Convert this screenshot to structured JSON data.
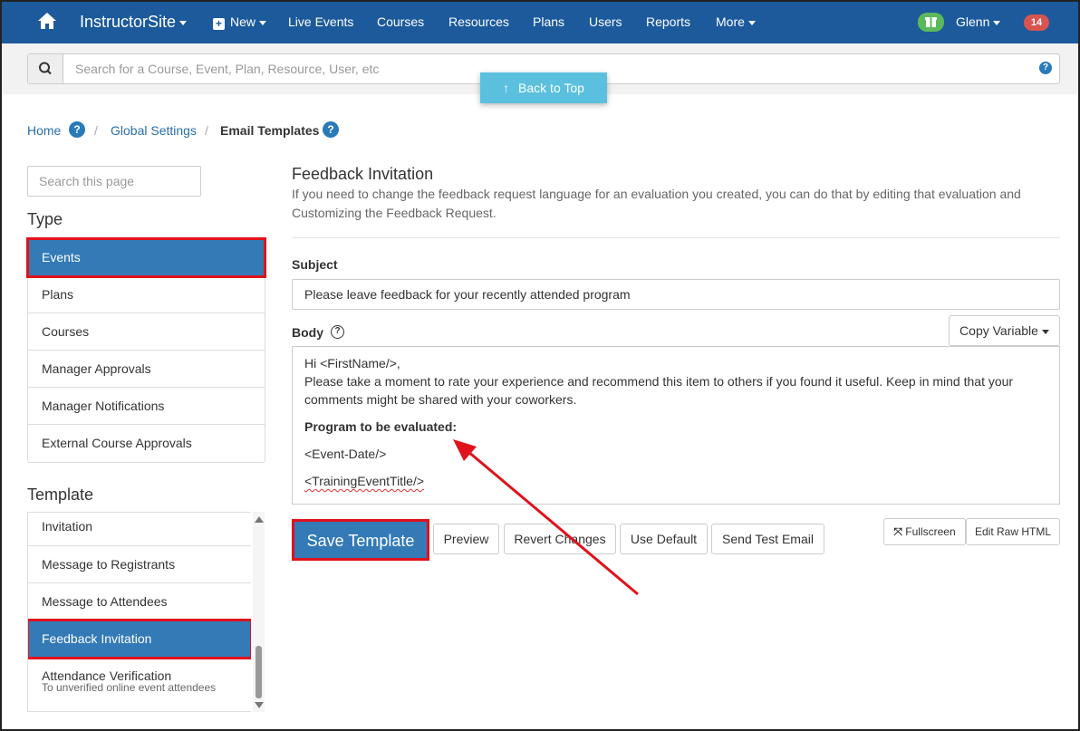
{
  "topnav": {
    "brand": "InstructorSite",
    "new_label": "New",
    "items": [
      "Live Events",
      "Courses",
      "Resources",
      "Plans",
      "Users",
      "Reports"
    ],
    "more_label": "More",
    "user_name": "Glenn",
    "notification_count": "14"
  },
  "search": {
    "placeholder": "Search for a Course, Event, Plan, Resource, User, etc"
  },
  "back_to_top": "Back to Top",
  "breadcrumb": {
    "home": "Home",
    "global_settings": "Global Settings",
    "current": "Email Templates",
    "separator": "/"
  },
  "sidebar": {
    "search_placeholder": "Search this page",
    "type_heading": "Type",
    "types": [
      "Events",
      "Plans",
      "Courses",
      "Manager Approvals",
      "Manager Notifications",
      "External Course Approvals"
    ],
    "template_heading": "Template",
    "templates": [
      "Invitation",
      "Message to Registrants",
      "Message to Attendees",
      "Feedback Invitation",
      "Attendance Verification"
    ],
    "attendance_sub": "To unverified online event attendees"
  },
  "main": {
    "title": "Feedback Invitation",
    "description": "If you need to change the feedback request language for an evaluation you created, you can do that by editing that evaluation and Customizing the Feedback Request.",
    "subject_label": "Subject",
    "subject_value": "Please leave feedback for your recently attended program",
    "body_label": "Body",
    "copy_variable": "Copy Variable",
    "body": {
      "line1": "Hi <FirstName/>,",
      "line2": "Please take a moment to rate your experience and recommend this item to others if you found it useful. Keep in mind that your comments might be shared with your coworkers.",
      "heading": "Program to be evaluated:",
      "var1": "<Event-Date/>",
      "var2": "<TrainingEventTitle/>"
    },
    "buttons": {
      "save": "Save Template",
      "preview": "Preview",
      "revert": "Revert Changes",
      "default": "Use Default",
      "test": "Send Test Email",
      "fullscreen": "Fullscreen",
      "raw": "Edit Raw HTML"
    }
  },
  "colors": {
    "nav": "#1c5a9c",
    "primary": "#337ab7",
    "highlight": "#e0121c",
    "back_to_top": "#5bc0de"
  }
}
